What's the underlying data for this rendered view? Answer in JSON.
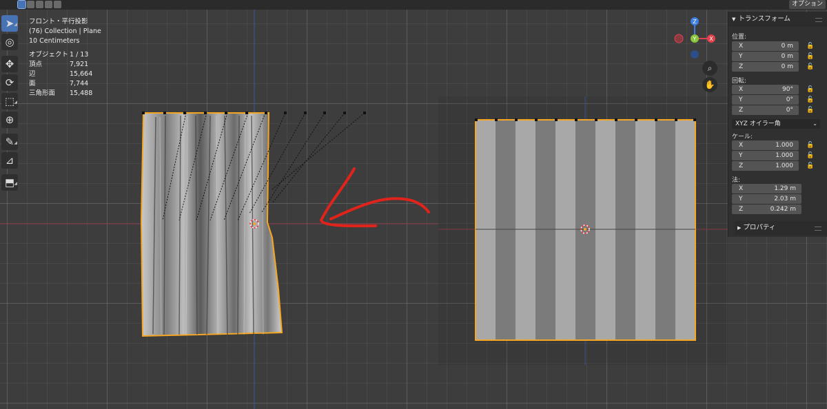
{
  "header": {
    "options_label": "オプション"
  },
  "viewport": {
    "view_name": "フロント・平行投影",
    "collection": "(76) Collection | Plane",
    "scale": "10 Centimeters"
  },
  "stats": [
    {
      "label": "オブジェクト",
      "value": "1 / 13"
    },
    {
      "label": "頂点",
      "value": "7,921"
    },
    {
      "label": "辺",
      "value": "15,664"
    },
    {
      "label": "面",
      "value": "7,744"
    },
    {
      "label": "三角形面",
      "value": "15,488"
    }
  ],
  "toolbar": [
    {
      "name": "select-tool",
      "icon": "cursor-arrow-icon",
      "glyph": "➤"
    },
    {
      "name": "cursor-tool",
      "icon": "3d-cursor-icon",
      "glyph": "◎"
    },
    {
      "name": "move-tool",
      "icon": "move-arrows-icon",
      "glyph": "✥"
    },
    {
      "name": "rotate-tool",
      "icon": "rotate-icon",
      "glyph": "⟳"
    },
    {
      "name": "scale-tool",
      "icon": "scale-icon",
      "glyph": "⬚"
    },
    {
      "name": "transform-tool",
      "icon": "transform-icon",
      "glyph": "⊕"
    },
    {
      "name": "annotate-tool",
      "icon": "annotate-pencil-icon",
      "glyph": "✎"
    },
    {
      "name": "measure-tool",
      "icon": "ruler-icon",
      "glyph": "📐"
    },
    {
      "name": "add-cube-tool",
      "icon": "add-cube-icon",
      "glyph": "⬒"
    }
  ],
  "gizmo": {
    "axes": [
      "Z",
      "Y",
      "X"
    ],
    "colors": {
      "x": "#e0424b",
      "y": "#8bc53f",
      "z": "#3d7ee0"
    }
  },
  "nav_buttons": [
    {
      "name": "zoom-icon",
      "glyph": "🔍"
    },
    {
      "name": "pan-hand-icon",
      "glyph": "✋"
    }
  ],
  "transform_panel": {
    "title": "トランスフォーム",
    "location_label": "位置:",
    "location": [
      {
        "axis": "X",
        "value": "0 m"
      },
      {
        "axis": "Y",
        "value": "0 m"
      },
      {
        "axis": "Z",
        "value": "0 m"
      }
    ],
    "rotation_label": "回転:",
    "rotation": [
      {
        "axis": "X",
        "value": "90°"
      },
      {
        "axis": "Y",
        "value": "0°"
      },
      {
        "axis": "Z",
        "value": "0°"
      }
    ],
    "rotation_mode": "XYZ オイラー角",
    "scale_label": "ケール:",
    "scale": [
      {
        "axis": "X",
        "value": "1.000"
      },
      {
        "axis": "Y",
        "value": "1.000"
      },
      {
        "axis": "Z",
        "value": "1.000"
      }
    ],
    "dimensions_label": "法:",
    "dimensions": [
      {
        "axis": "X",
        "value": "1.29 m"
      },
      {
        "axis": "Y",
        "value": "2.03 m"
      },
      {
        "axis": "Z",
        "value": "0.242 m"
      }
    ]
  },
  "properties_panel": {
    "title": "プロパティ"
  },
  "colors": {
    "selection_outline": "#f5a623",
    "x_axis_line": "#9a3a46",
    "z_axis_line": "#3f5f9c",
    "annotation_stroke": "#e0231b",
    "active_tool": "#4772b3"
  }
}
